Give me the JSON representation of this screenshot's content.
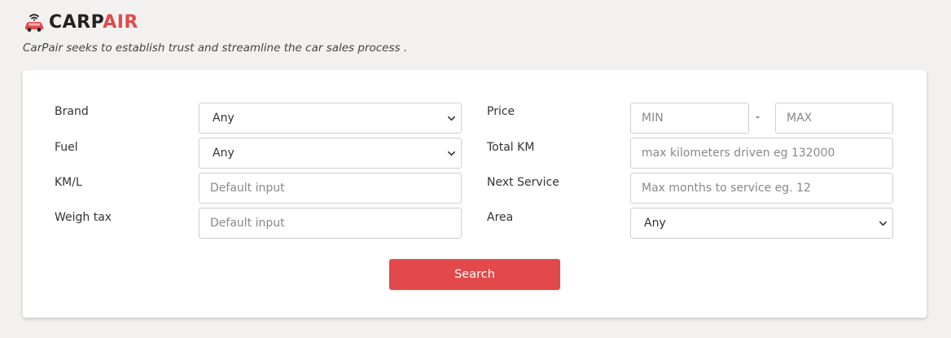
{
  "brand": {
    "name_part1": "CARP",
    "name_part2": "AIR",
    "tagline": "CarPair seeks to establish trust and streamline the car sales process ."
  },
  "filters": {
    "brand": {
      "label": "Brand",
      "value": "Any"
    },
    "fuel": {
      "label": "Fuel",
      "value": "Any"
    },
    "kml": {
      "label": "KM/L",
      "placeholder": "Default input"
    },
    "weigh_tax": {
      "label": "Weigh tax",
      "placeholder": "Default input"
    },
    "price": {
      "label": "Price",
      "min_placeholder": "MIN",
      "separator": "-",
      "max_placeholder": "MAX"
    },
    "total_km": {
      "label": "Total KM",
      "placeholder": "max kilometers driven eg 132000"
    },
    "next_service": {
      "label": "Next Service",
      "placeholder": "Max months to service eg. 12"
    },
    "area": {
      "label": "Area",
      "value": "Any"
    }
  },
  "search_button": {
    "label": "Search"
  },
  "colors": {
    "accent": "#e2494b",
    "background": "#f2f1f0",
    "card": "#ffffff"
  }
}
